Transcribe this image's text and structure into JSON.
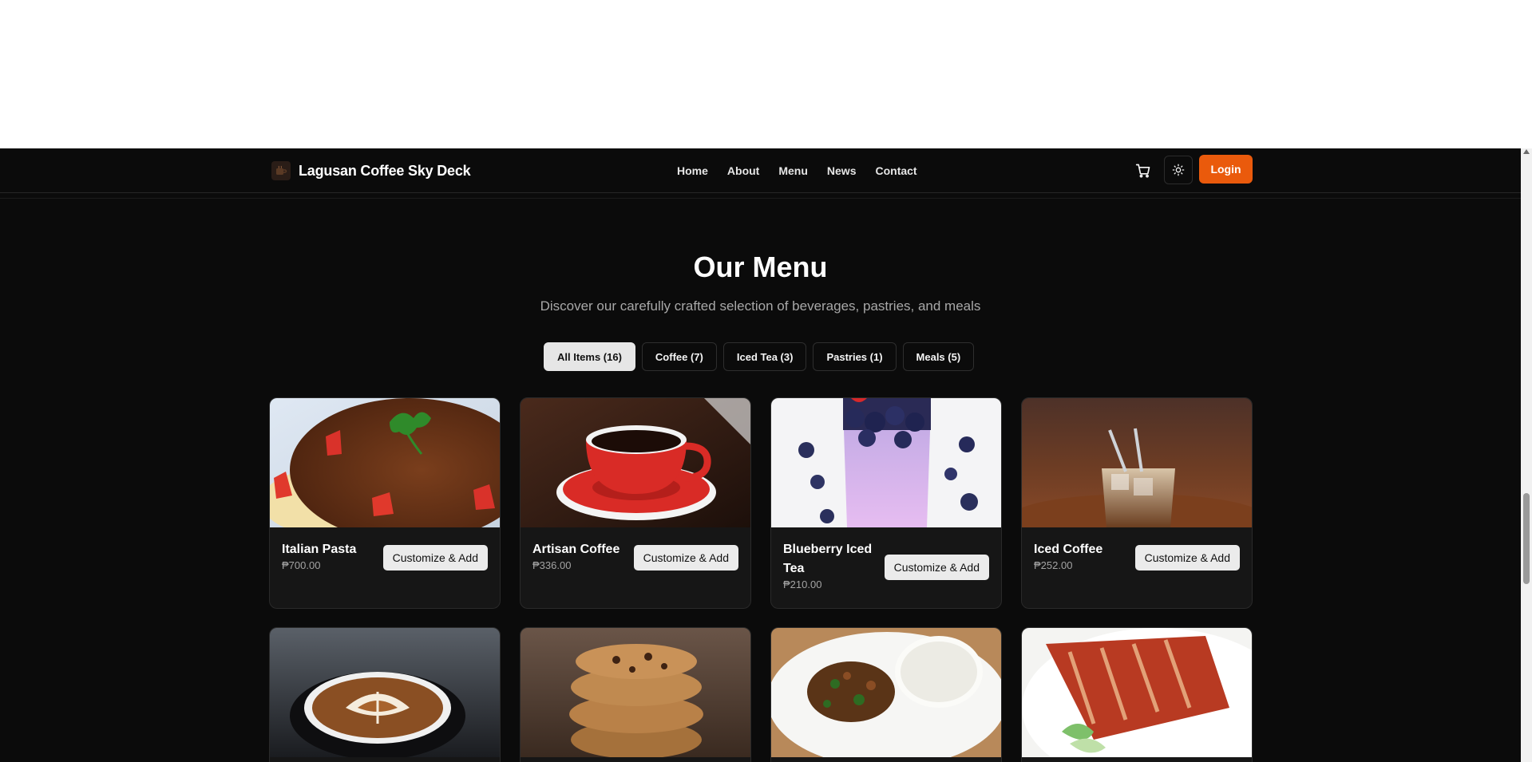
{
  "brand": {
    "name": "Lagusan Coffee Sky Deck",
    "logo_icon": "coffee-logo-icon"
  },
  "nav": {
    "links": [
      "Home",
      "About",
      "Menu",
      "News",
      "Contact"
    ]
  },
  "header_actions": {
    "cart_icon": "cart-icon",
    "theme_icon": "sun-icon",
    "login_label": "Login",
    "login_color": "#ea5a0c"
  },
  "menu": {
    "title": "Our Menu",
    "subtitle": "Discover our carefully crafted selection of beverages, pastries, and meals"
  },
  "filters": [
    {
      "label": "All Items (16)",
      "active": true
    },
    {
      "label": "Coffee (7)",
      "active": false
    },
    {
      "label": "Iced Tea (3)",
      "active": false
    },
    {
      "label": "Pastries (1)",
      "active": false
    },
    {
      "label": "Meals (5)",
      "active": false
    }
  ],
  "items": [
    {
      "name": "Italian Pasta",
      "price": "₱700.00",
      "button": "Customize & Add",
      "image": "pasta-image"
    },
    {
      "name": "Artisan Coffee",
      "price": "₱336.00",
      "button": "Customize & Add",
      "image": "red-coffee-cup-image"
    },
    {
      "name": "Blueberry Iced Tea",
      "price": "₱210.00",
      "button": "Customize & Add",
      "image": "blueberry-drink-image"
    },
    {
      "name": "Iced Coffee",
      "price": "₱252.00",
      "button": "Customize & Add",
      "image": "iced-coffee-image"
    },
    {
      "image": "latte-art-image"
    },
    {
      "image": "cookies-image"
    },
    {
      "image": "rice-meal-image"
    },
    {
      "image": "grilled-meat-image"
    }
  ]
}
